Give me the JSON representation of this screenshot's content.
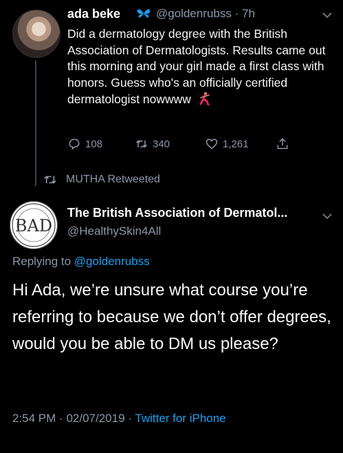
{
  "tweet": {
    "author_name": "ada beke",
    "author_handle": "@goldenrubss",
    "time_ago": "7h",
    "text": "Did a dermatology degree with the British Association of Dermatologists. Results came out this morning and your girl made a first class with honors. Guess who's an officially certified dermatologist nowwww",
    "replies": "108",
    "retweets": "340",
    "likes": "1,261",
    "icons": [
      "verified-butterfly-icon",
      "dancer-emoji-icon",
      "reply-icon",
      "retweet-icon",
      "like-icon",
      "share-icon",
      "chevron-down-icon"
    ]
  },
  "retweet_notice": {
    "text": "MUTHA Retweeted"
  },
  "reply": {
    "author_name": "The British Association of Dermatol...",
    "author_handle": "@HealthySkin4All",
    "replying_prefix": "Replying to",
    "replying_to": "@goldenrubss",
    "text": "Hi Ada, we’re unsure what course you’re referring to because we don’t offer degrees, would you be able to DM us please?",
    "time": "2:54 PM",
    "date": "02/07/2019",
    "client": "Twitter for iPhone"
  },
  "colors": {
    "background": "#000000",
    "muted": "#8b98a5",
    "link": "#1da1f2",
    "verified_butterfly": "#1d9bf0"
  }
}
